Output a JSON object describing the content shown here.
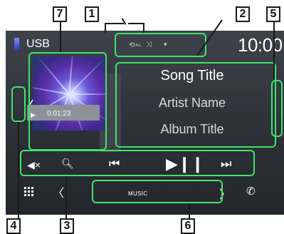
{
  "status_bar": {
    "source": "USB",
    "clock": "10:00"
  },
  "playback": {
    "elapsed": "0:01:23"
  },
  "track": {
    "song_title": "Song Title",
    "artist_name": "Artist Name",
    "album_title": "Album Title"
  },
  "source_bar": {
    "label": "MUSIC"
  },
  "callouts": [
    "1",
    "2",
    "3",
    "4",
    "5",
    "6",
    "7"
  ],
  "icons": {
    "repeat": "repeat-all-icon",
    "shuffle": "shuffle-icon",
    "mute": "mute-icon",
    "search": "search-icon",
    "previous": "previous-track-icon",
    "play_pause": "play-pause-icon",
    "next": "next-track-icon",
    "home": "grid-menu-icon",
    "phone": "phone-icon"
  },
  "colors": {
    "highlight": "#3fe36a",
    "screen_bg": "#2c3037",
    "usb_icon": "#4a59d8"
  }
}
